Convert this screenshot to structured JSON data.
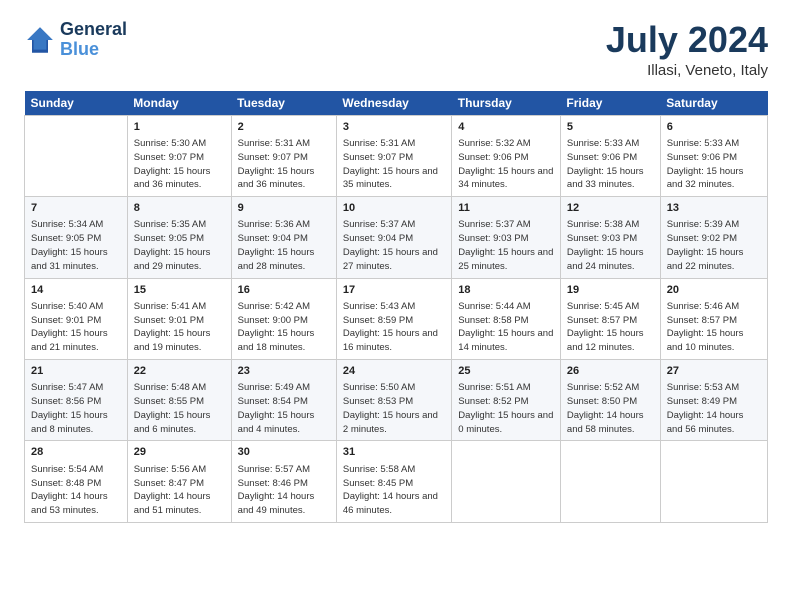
{
  "logo": {
    "line1": "General",
    "line2": "Blue"
  },
  "title": "July 2024",
  "subtitle": "Illasi, Veneto, Italy",
  "days_header": [
    "Sunday",
    "Monday",
    "Tuesday",
    "Wednesday",
    "Thursday",
    "Friday",
    "Saturday"
  ],
  "weeks": [
    [
      {
        "num": "",
        "sunrise": "",
        "sunset": "",
        "daylight": ""
      },
      {
        "num": "1",
        "sunrise": "Sunrise: 5:30 AM",
        "sunset": "Sunset: 9:07 PM",
        "daylight": "Daylight: 15 hours and 36 minutes."
      },
      {
        "num": "2",
        "sunrise": "Sunrise: 5:31 AM",
        "sunset": "Sunset: 9:07 PM",
        "daylight": "Daylight: 15 hours and 36 minutes."
      },
      {
        "num": "3",
        "sunrise": "Sunrise: 5:31 AM",
        "sunset": "Sunset: 9:07 PM",
        "daylight": "Daylight: 15 hours and 35 minutes."
      },
      {
        "num": "4",
        "sunrise": "Sunrise: 5:32 AM",
        "sunset": "Sunset: 9:06 PM",
        "daylight": "Daylight: 15 hours and 34 minutes."
      },
      {
        "num": "5",
        "sunrise": "Sunrise: 5:33 AM",
        "sunset": "Sunset: 9:06 PM",
        "daylight": "Daylight: 15 hours and 33 minutes."
      },
      {
        "num": "6",
        "sunrise": "Sunrise: 5:33 AM",
        "sunset": "Sunset: 9:06 PM",
        "daylight": "Daylight: 15 hours and 32 minutes."
      }
    ],
    [
      {
        "num": "7",
        "sunrise": "Sunrise: 5:34 AM",
        "sunset": "Sunset: 9:05 PM",
        "daylight": "Daylight: 15 hours and 31 minutes."
      },
      {
        "num": "8",
        "sunrise": "Sunrise: 5:35 AM",
        "sunset": "Sunset: 9:05 PM",
        "daylight": "Daylight: 15 hours and 29 minutes."
      },
      {
        "num": "9",
        "sunrise": "Sunrise: 5:36 AM",
        "sunset": "Sunset: 9:04 PM",
        "daylight": "Daylight: 15 hours and 28 minutes."
      },
      {
        "num": "10",
        "sunrise": "Sunrise: 5:37 AM",
        "sunset": "Sunset: 9:04 PM",
        "daylight": "Daylight: 15 hours and 27 minutes."
      },
      {
        "num": "11",
        "sunrise": "Sunrise: 5:37 AM",
        "sunset": "Sunset: 9:03 PM",
        "daylight": "Daylight: 15 hours and 25 minutes."
      },
      {
        "num": "12",
        "sunrise": "Sunrise: 5:38 AM",
        "sunset": "Sunset: 9:03 PM",
        "daylight": "Daylight: 15 hours and 24 minutes."
      },
      {
        "num": "13",
        "sunrise": "Sunrise: 5:39 AM",
        "sunset": "Sunset: 9:02 PM",
        "daylight": "Daylight: 15 hours and 22 minutes."
      }
    ],
    [
      {
        "num": "14",
        "sunrise": "Sunrise: 5:40 AM",
        "sunset": "Sunset: 9:01 PM",
        "daylight": "Daylight: 15 hours and 21 minutes."
      },
      {
        "num": "15",
        "sunrise": "Sunrise: 5:41 AM",
        "sunset": "Sunset: 9:01 PM",
        "daylight": "Daylight: 15 hours and 19 minutes."
      },
      {
        "num": "16",
        "sunrise": "Sunrise: 5:42 AM",
        "sunset": "Sunset: 9:00 PM",
        "daylight": "Daylight: 15 hours and 18 minutes."
      },
      {
        "num": "17",
        "sunrise": "Sunrise: 5:43 AM",
        "sunset": "Sunset: 8:59 PM",
        "daylight": "Daylight: 15 hours and 16 minutes."
      },
      {
        "num": "18",
        "sunrise": "Sunrise: 5:44 AM",
        "sunset": "Sunset: 8:58 PM",
        "daylight": "Daylight: 15 hours and 14 minutes."
      },
      {
        "num": "19",
        "sunrise": "Sunrise: 5:45 AM",
        "sunset": "Sunset: 8:57 PM",
        "daylight": "Daylight: 15 hours and 12 minutes."
      },
      {
        "num": "20",
        "sunrise": "Sunrise: 5:46 AM",
        "sunset": "Sunset: 8:57 PM",
        "daylight": "Daylight: 15 hours and 10 minutes."
      }
    ],
    [
      {
        "num": "21",
        "sunrise": "Sunrise: 5:47 AM",
        "sunset": "Sunset: 8:56 PM",
        "daylight": "Daylight: 15 hours and 8 minutes."
      },
      {
        "num": "22",
        "sunrise": "Sunrise: 5:48 AM",
        "sunset": "Sunset: 8:55 PM",
        "daylight": "Daylight: 15 hours and 6 minutes."
      },
      {
        "num": "23",
        "sunrise": "Sunrise: 5:49 AM",
        "sunset": "Sunset: 8:54 PM",
        "daylight": "Daylight: 15 hours and 4 minutes."
      },
      {
        "num": "24",
        "sunrise": "Sunrise: 5:50 AM",
        "sunset": "Sunset: 8:53 PM",
        "daylight": "Daylight: 15 hours and 2 minutes."
      },
      {
        "num": "25",
        "sunrise": "Sunrise: 5:51 AM",
        "sunset": "Sunset: 8:52 PM",
        "daylight": "Daylight: 15 hours and 0 minutes."
      },
      {
        "num": "26",
        "sunrise": "Sunrise: 5:52 AM",
        "sunset": "Sunset: 8:50 PM",
        "daylight": "Daylight: 14 hours and 58 minutes."
      },
      {
        "num": "27",
        "sunrise": "Sunrise: 5:53 AM",
        "sunset": "Sunset: 8:49 PM",
        "daylight": "Daylight: 14 hours and 56 minutes."
      }
    ],
    [
      {
        "num": "28",
        "sunrise": "Sunrise: 5:54 AM",
        "sunset": "Sunset: 8:48 PM",
        "daylight": "Daylight: 14 hours and 53 minutes."
      },
      {
        "num": "29",
        "sunrise": "Sunrise: 5:56 AM",
        "sunset": "Sunset: 8:47 PM",
        "daylight": "Daylight: 14 hours and 51 minutes."
      },
      {
        "num": "30",
        "sunrise": "Sunrise: 5:57 AM",
        "sunset": "Sunset: 8:46 PM",
        "daylight": "Daylight: 14 hours and 49 minutes."
      },
      {
        "num": "31",
        "sunrise": "Sunrise: 5:58 AM",
        "sunset": "Sunset: 8:45 PM",
        "daylight": "Daylight: 14 hours and 46 minutes."
      },
      {
        "num": "",
        "sunrise": "",
        "sunset": "",
        "daylight": ""
      },
      {
        "num": "",
        "sunrise": "",
        "sunset": "",
        "daylight": ""
      },
      {
        "num": "",
        "sunrise": "",
        "sunset": "",
        "daylight": ""
      }
    ]
  ]
}
